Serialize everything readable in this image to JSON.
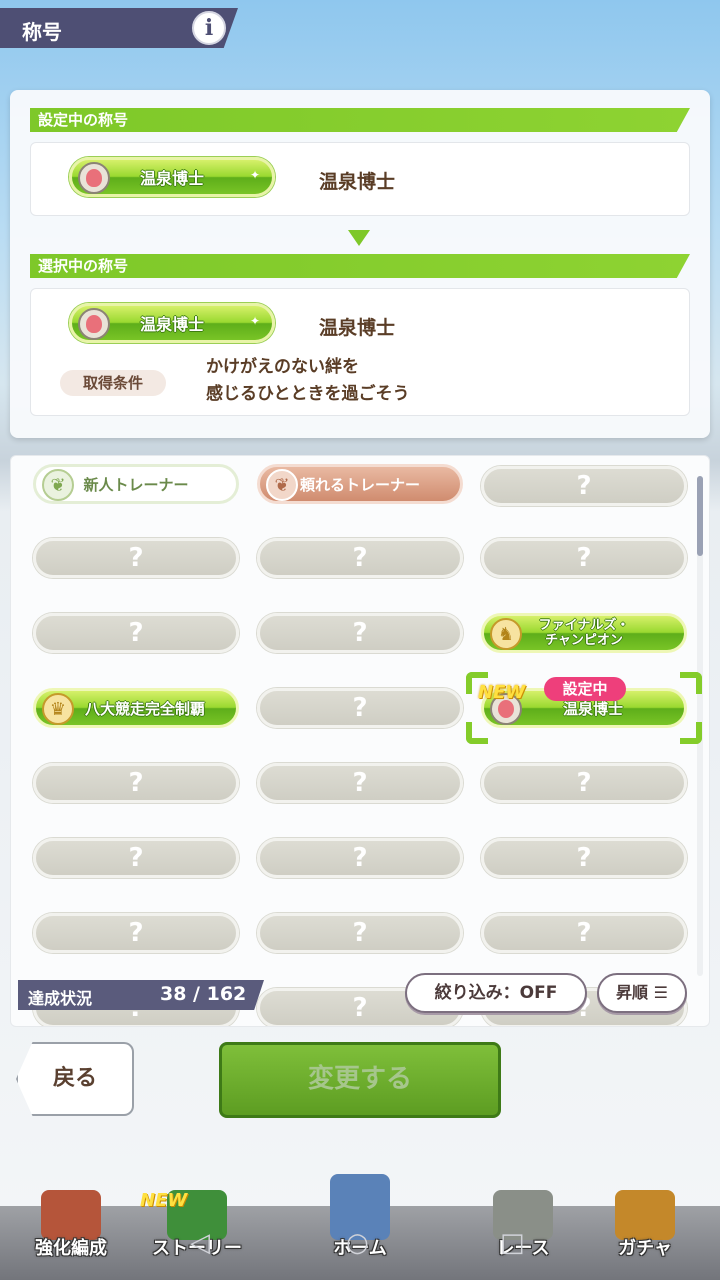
{
  "header": {
    "title": "称号",
    "info_label": "i"
  },
  "current_section": {
    "label": "設定中の称号",
    "badge": "温泉博士",
    "name": "温泉博士"
  },
  "selected_section": {
    "label": "選択中の称号",
    "badge": "温泉博士",
    "name": "温泉博士",
    "condition_label": "取得条件",
    "condition_lines": [
      "かけがえのない絆を",
      "感じるひとときを過ごそう"
    ]
  },
  "list": {
    "chips": {
      "new_trainer": "新人トレーナー",
      "reliable_trainer": "頼れるトレーナー",
      "finals_line1": "ファイナルズ・",
      "finals_line2": "チャンピオン",
      "eight_race": "八大競走完全制覇",
      "onsen": "温泉博士"
    },
    "locked": "?",
    "new_tag": "NEW",
    "setting_tag": "設定中"
  },
  "progress": {
    "label": "達成状況",
    "value": "38 / 162"
  },
  "filter_label": "絞り込み：OFF",
  "sort_label": "昇順",
  "back_label": "戻る",
  "change_label": "変更する",
  "nav": {
    "new_tag": "NEW",
    "items": [
      "強化編成",
      "ストーリー",
      "ホーム",
      "レース",
      "ガチャ"
    ]
  },
  "colors": {
    "accent_green": "#7ec829",
    "header_bg": "#4e4f74",
    "setting_pink": "#ee3f7b"
  }
}
